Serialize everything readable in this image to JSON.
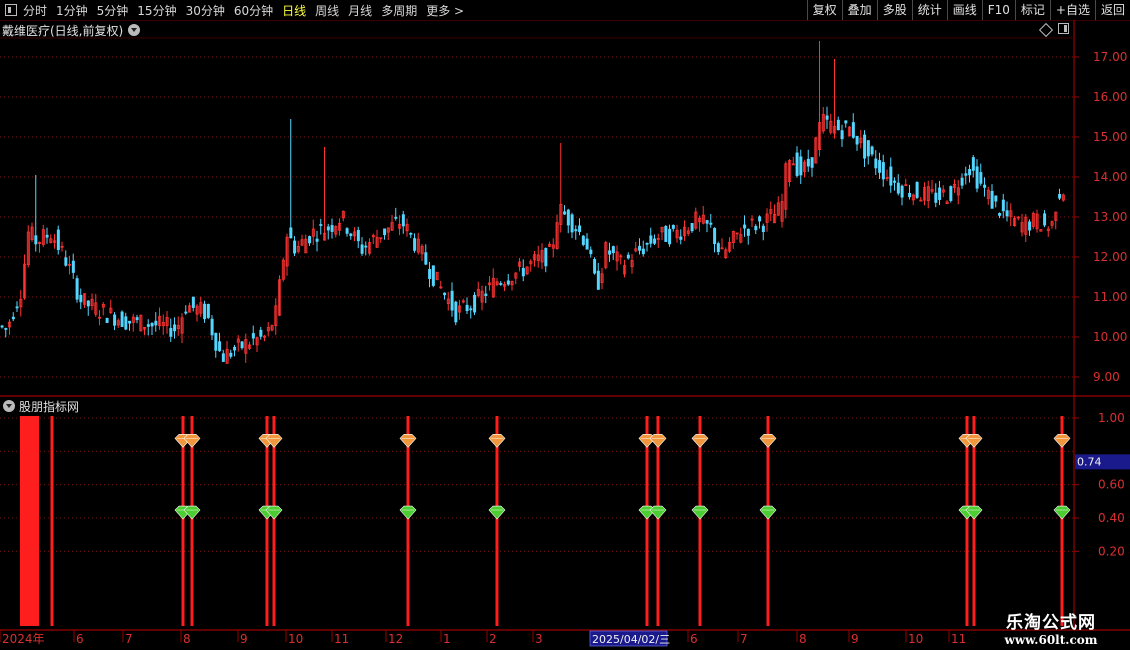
{
  "toolbar": {
    "periods": [
      "分时",
      "1分钟",
      "5分钟",
      "15分钟",
      "30分钟",
      "60分钟",
      "日线",
      "周线",
      "月线",
      "多周期",
      "更多 >"
    ],
    "active_period": "日线",
    "buttons": [
      "复权",
      "叠加",
      "多股",
      "统计",
      "画线",
      "F10",
      "标记",
      "+自选",
      "返回"
    ]
  },
  "price_panel": {
    "title": "戴维医疗(日线,前复权)",
    "y_ticks": [
      "17.00",
      "16.00",
      "15.00",
      "14.00",
      "13.00",
      "12.00",
      "11.00",
      "10.00",
      "9.00"
    ]
  },
  "indicator_panel": {
    "title": "股朋指标网",
    "y_ticks": [
      "1.00",
      "0.74",
      "0.60",
      "0.40",
      "0.20"
    ],
    "current_value": "0.74"
  },
  "x_axis": {
    "labels": [
      "2024年",
      "6",
      "7",
      "8",
      "9",
      "10",
      "11",
      "12",
      "1",
      "2",
      "3",
      "2025/04/02/三",
      "6",
      "7",
      "8",
      "9",
      "10",
      "11"
    ],
    "cursor_date": "2025/04/02/三"
  },
  "watermark": {
    "title": "乐淘公式网",
    "url": "www.60lt.com"
  },
  "colors": {
    "up": "#ff3232",
    "down": "#54d6ff",
    "signal": "#ff1e1e",
    "top_diamond": "#f0963c",
    "bottom_diamond": "#4ccd32"
  },
  "chart_data": [
    {
      "type": "candlestick",
      "title": "戴维医疗(日线,前复权)",
      "ylim": [
        8.7,
        17.5
      ],
      "y_ticks": [
        9,
        10,
        11,
        12,
        13,
        14,
        15,
        16,
        17
      ],
      "x_labels": [
        "2024年",
        "6",
        "7",
        "8",
        "9",
        "10",
        "11",
        "12",
        "1",
        "2",
        "3",
        "2025/04/02/三",
        "6",
        "7",
        "8",
        "9",
        "10",
        "11"
      ],
      "close_profile_points": [
        [
          0,
          10.3
        ],
        [
          10,
          10.2
        ],
        [
          25,
          11.2
        ],
        [
          32,
          12.6
        ],
        [
          40,
          12.4
        ],
        [
          55,
          12.6
        ],
        [
          70,
          11.9
        ],
        [
          85,
          10.9
        ],
        [
          100,
          10.7
        ],
        [
          130,
          10.4
        ],
        [
          160,
          10.3
        ],
        [
          180,
          10.2
        ],
        [
          190,
          10.8
        ],
        [
          210,
          10.6
        ],
        [
          225,
          9.5
        ],
        [
          240,
          9.7
        ],
        [
          255,
          9.9
        ],
        [
          270,
          10.0
        ],
        [
          280,
          10.6
        ],
        [
          290,
          12.6
        ],
        [
          300,
          12.2
        ],
        [
          315,
          12.6
        ],
        [
          330,
          12.7
        ],
        [
          345,
          13.0
        ],
        [
          365,
          12.2
        ],
        [
          385,
          12.6
        ],
        [
          405,
          12.9
        ],
        [
          420,
          12.3
        ],
        [
          440,
          11.4
        ],
        [
          460,
          10.6
        ],
        [
          480,
          10.9
        ],
        [
          500,
          11.4
        ],
        [
          520,
          11.6
        ],
        [
          540,
          11.9
        ],
        [
          555,
          12.1
        ],
        [
          562,
          13.2
        ],
        [
          575,
          12.9
        ],
        [
          590,
          12.4
        ],
        [
          600,
          11.2
        ],
        [
          610,
          12.2
        ],
        [
          625,
          11.8
        ],
        [
          640,
          12.1
        ],
        [
          660,
          12.5
        ],
        [
          680,
          12.6
        ],
        [
          700,
          12.9
        ],
        [
          715,
          12.7
        ],
        [
          725,
          12.0
        ],
        [
          745,
          12.7
        ],
        [
          770,
          12.9
        ],
        [
          785,
          13.2
        ],
        [
          792,
          14.6
        ],
        [
          805,
          14.1
        ],
        [
          815,
          14.4
        ],
        [
          825,
          15.4
        ],
        [
          840,
          15.2
        ],
        [
          855,
          15.2
        ],
        [
          870,
          14.6
        ],
        [
          885,
          14.2
        ],
        [
          900,
          13.8
        ],
        [
          920,
          13.6
        ],
        [
          940,
          13.5
        ],
        [
          955,
          13.6
        ],
        [
          972,
          14.3
        ],
        [
          985,
          13.8
        ],
        [
          995,
          13.4
        ],
        [
          1010,
          13.0
        ],
        [
          1025,
          12.8
        ],
        [
          1040,
          12.9
        ],
        [
          1055,
          12.7
        ],
        [
          1060,
          13.4
        ],
        [
          1064,
          13.7
        ]
      ],
      "spikes": [
        [
          35,
          14.05
        ],
        [
          289,
          15.45
        ],
        [
          325,
          14.75
        ],
        [
          559,
          14.85
        ],
        [
          818,
          17.4
        ],
        [
          836,
          16.95
        ],
        [
          972,
          14.55
        ]
      ]
    },
    {
      "type": "signal",
      "title": "股朋指标网",
      "ylim": [
        0.1,
        1.1
      ],
      "y_ticks": [
        1.0,
        0.8,
        0.6,
        0.4,
        0.2
      ],
      "top_diamond_level": 0.86,
      "bottom_diamond_level": 0.43,
      "current_value": 0.74,
      "signal_positions": [
        183,
        192,
        267,
        274,
        408,
        497,
        647,
        658,
        700,
        768,
        967,
        974,
        1062
      ],
      "solo_lines": [
        52
      ],
      "bar_block": [
        20,
        39
      ]
    }
  ]
}
